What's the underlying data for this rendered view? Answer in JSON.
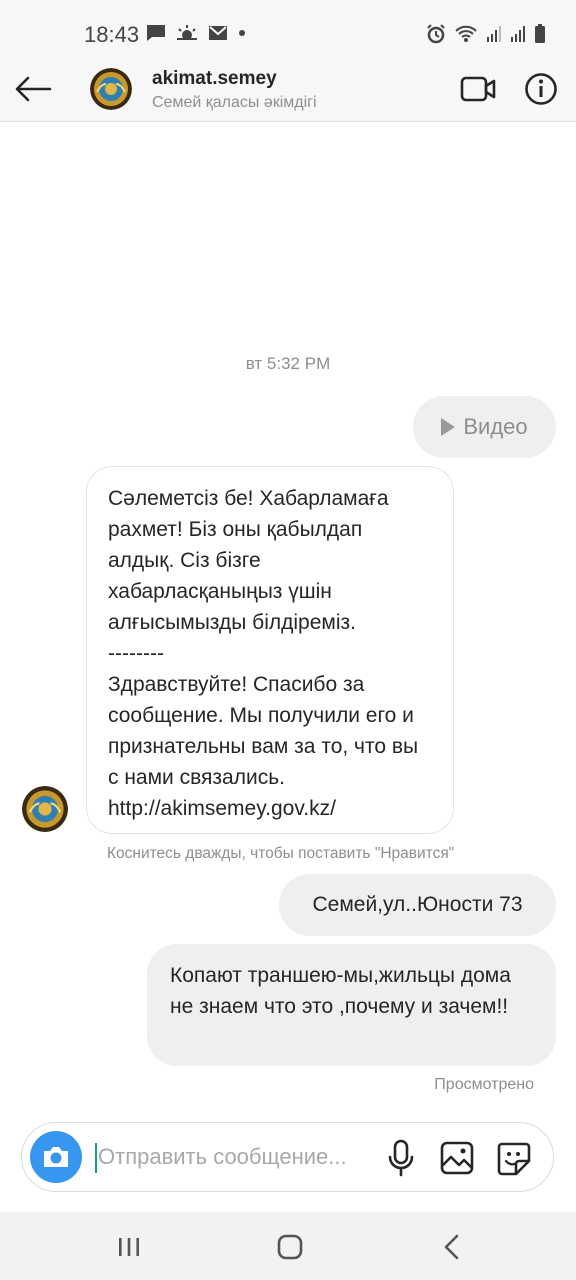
{
  "status_bar": {
    "time": "18:43",
    "icons_left": [
      "chat-icon",
      "weather-icon",
      "mail-icon",
      "dot-icon"
    ],
    "icons_right": [
      "alarm-icon",
      "wifi-icon",
      "signal-icon",
      "signal-icon",
      "battery-icon"
    ]
  },
  "header": {
    "username": "akimat.semey",
    "subtitle": "Семей қаласы әкімдігі"
  },
  "conversation": {
    "timestamp": "вт 5:32 PM",
    "outgoing_video_label": "Видео",
    "incoming_message": "Сәлеметсіз бе! Хабарламаға рахмет! Біз оны қабылдап алдық. Сіз бізге хабарласқаныңыз үшін алғысымызды білдіреміз.\n--------\nЗдравствуйте! Спасибо за сообщение. Мы получили его и признательны вам за то, что вы с нами связались.\nhttp://akimsemey.gov.kz/",
    "like_hint": "Коснитесь дважды, чтобы поставить \"Нравится\"",
    "outgoing_message_1": "Семей,ул..Юности 73",
    "outgoing_message_2": "Копают траншею-мы,жильцы дома не знаем что это ,почему и зачем!!",
    "seen_label": "Просмотрено"
  },
  "composer": {
    "placeholder": "Отправить сообщение...",
    "value": ""
  },
  "colors": {
    "accent": "#3797f0",
    "bubble_grey": "#efefef",
    "secondary_text": "#8e8e8e"
  }
}
